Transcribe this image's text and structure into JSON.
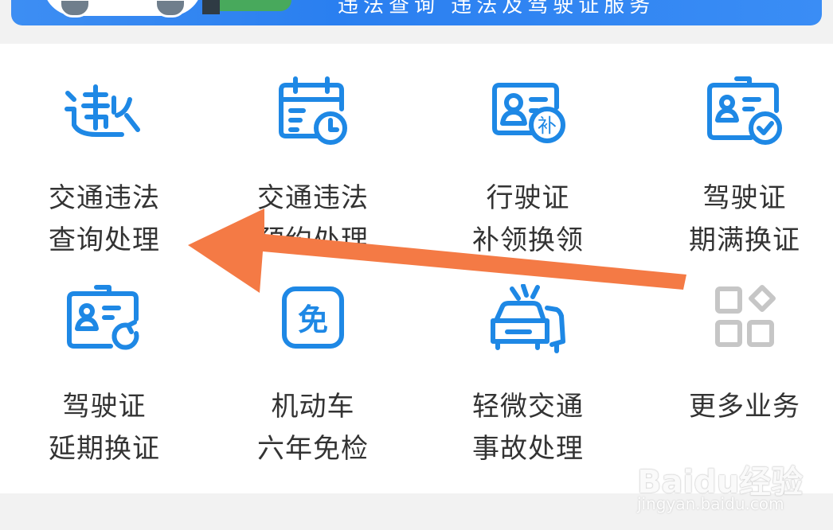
{
  "banner": {
    "text": "违法查询 违法及驾驶证服务",
    "colors": {
      "background": "#2a7ff0",
      "grass": "#48a95c"
    }
  },
  "services": [
    {
      "icon": "violation-query-icon",
      "line1": "交通违法",
      "line2": "查询处理"
    },
    {
      "icon": "calendar-clock-icon",
      "line1": "交通违法",
      "line2": "预约处理"
    },
    {
      "icon": "license-reissue-icon",
      "line1": "行驶证",
      "line2": "补领换领"
    },
    {
      "icon": "license-check-icon",
      "line1": "驾驶证",
      "line2": "期满换证"
    },
    {
      "icon": "license-renew-icon",
      "line1": "驾驶证",
      "line2": "延期换证"
    },
    {
      "icon": "exempt-badge-icon",
      "line1": "机动车",
      "line2": "六年免检"
    },
    {
      "icon": "car-accident-icon",
      "line1": "轻微交通",
      "line2": "事故处理"
    },
    {
      "icon": "grid-more-icon",
      "line1": "更多业务",
      "line2": ""
    }
  ],
  "badges": {
    "reissue": "补",
    "exempt": "免"
  },
  "annotation": {
    "type": "arrow",
    "color": "#f47a45",
    "points_to": "交通违法 查询处理"
  },
  "watermark": {
    "brand": "Baidu经验",
    "url": "jingyan.baidu.com"
  },
  "colors": {
    "icon_blue": "#1e88e5",
    "icon_gray": "#c6c6c6",
    "label": "#333333",
    "page_bg": "#f2f2f2"
  }
}
